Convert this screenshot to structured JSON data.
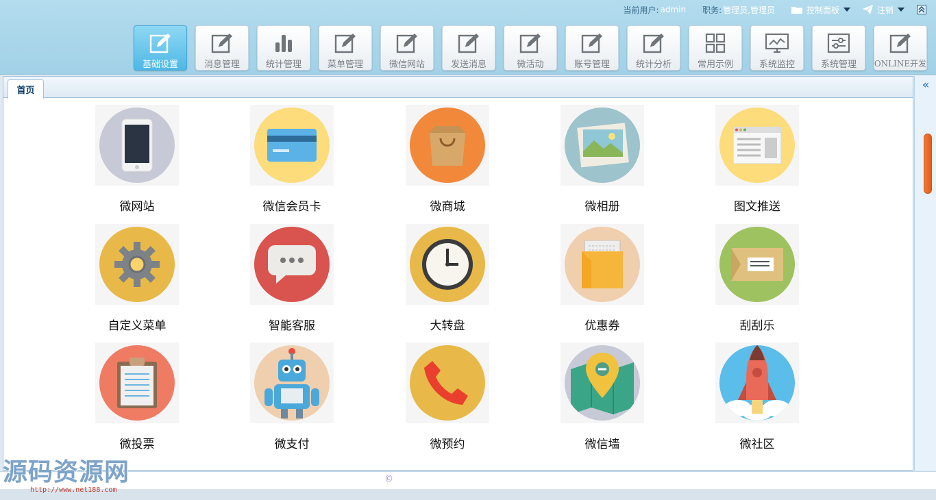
{
  "header": {
    "user_label": "当前用户:",
    "user_value": "admin",
    "role_label": "职务:",
    "role_value": "管理员,管理员",
    "control_panel": "控制面板",
    "logout": "注销"
  },
  "toolbar": {
    "items": [
      {
        "label": "基础设置",
        "icon": "edit-icon",
        "active": true
      },
      {
        "label": "消息管理",
        "icon": "edit-icon"
      },
      {
        "label": "统计管理",
        "icon": "bar-chart-icon"
      },
      {
        "label": "菜单管理",
        "icon": "edit-icon"
      },
      {
        "label": "微信网站",
        "icon": "edit-icon"
      },
      {
        "label": "发送消息",
        "icon": "edit-icon"
      },
      {
        "label": "微活动",
        "icon": "edit-icon"
      },
      {
        "label": "账号管理",
        "icon": "edit-icon"
      },
      {
        "label": "统计分析",
        "icon": "edit-icon"
      },
      {
        "label": "常用示例",
        "icon": "grid-icon"
      },
      {
        "label": "系统监控",
        "icon": "monitor-icon"
      },
      {
        "label": "系统管理",
        "icon": "settings-panel-icon"
      },
      {
        "label": "ONLINE开发",
        "icon": "edit-icon"
      }
    ]
  },
  "tabs": {
    "home": "首页"
  },
  "apps": [
    {
      "label": "微网站",
      "icon": "phone-icon",
      "color": "#c7c9d6"
    },
    {
      "label": "微信会员卡",
      "icon": "card-icon",
      "color": "#fcdc7b"
    },
    {
      "label": "微商城",
      "icon": "shopping-bag-icon",
      "color": "#f2883a"
    },
    {
      "label": "微相册",
      "icon": "photo-icon",
      "color": "#9dc3cc"
    },
    {
      "label": "图文推送",
      "icon": "webpage-icon",
      "color": "#fcdc7b"
    },
    {
      "label": "自定义菜单",
      "icon": "gear-icon",
      "color": "#e8b948"
    },
    {
      "label": "智能客服",
      "icon": "chat-bubble-icon",
      "color": "#d9534f"
    },
    {
      "label": "大转盘",
      "icon": "clock-icon",
      "color": "#e8b948"
    },
    {
      "label": "优惠券",
      "icon": "coupon-envelope-icon",
      "color": "#f0cfae"
    },
    {
      "label": "刮刮乐",
      "icon": "ticket-icon",
      "color": "#9ec25f"
    },
    {
      "label": "微投票",
      "icon": "clipboard-icon",
      "color": "#ef7b63"
    },
    {
      "label": "微支付",
      "icon": "robot-icon",
      "color": "#f0cfae"
    },
    {
      "label": "微预约",
      "icon": "telephone-icon",
      "color": "#e8b948"
    },
    {
      "label": "微信墙",
      "icon": "map-pin-icon",
      "color": "#c7c9d6"
    },
    {
      "label": "微社区",
      "icon": "rocket-icon",
      "color": "#5bbde9"
    }
  ],
  "footer": {
    "copyright": "©"
  },
  "watermark": {
    "text": "源码资源网",
    "url": "http://www.net188.com"
  },
  "colors": {
    "header_bg": "#a8d5ea",
    "active_button": "#4fb8e6",
    "scrollbar": "#e95a17"
  }
}
